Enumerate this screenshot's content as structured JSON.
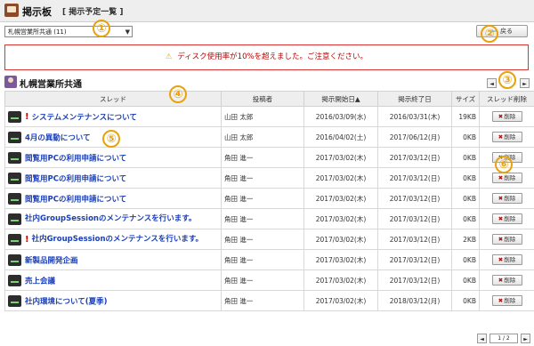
{
  "header": {
    "title": "掲示板",
    "subtitle": "[ 掲示予定一覧 ]"
  },
  "forum_select": {
    "value": "札幌営業所共通 (11)"
  },
  "back_button": {
    "label": "戻る"
  },
  "alert": {
    "text": "ディスク使用率が10%を超えました。ご注意ください。"
  },
  "group": {
    "title": "札幌営業所共通"
  },
  "markers": [
    "①",
    "②",
    "③",
    "④",
    "⑤",
    "⑥"
  ],
  "table": {
    "headers": {
      "thread": "スレッド",
      "poster": "投稿者",
      "start": "掲示開始日▲",
      "end": "掲示終了日",
      "size": "サイズ",
      "delete": "スレッド削除"
    },
    "delete_label": "削除",
    "rows": [
      {
        "title": "システムメンテナンスについて",
        "important": true,
        "poster": "山田 太郎",
        "start": "2016/03/09(水)",
        "end": "2016/03/31(木)",
        "size": "19KB"
      },
      {
        "title": "4月の異動について",
        "important": false,
        "poster": "山田 太郎",
        "start": "2016/04/02(土)",
        "end": "2017/06/12(月)",
        "size": "0KB"
      },
      {
        "title": "閲覧用PCの利用申請について",
        "important": false,
        "poster": "角田 進一",
        "start": "2017/03/02(木)",
        "end": "2017/03/12(日)",
        "size": "0KB"
      },
      {
        "title": "閲覧用PCの利用申請について",
        "important": false,
        "poster": "角田 進一",
        "start": "2017/03/02(木)",
        "end": "2017/03/12(日)",
        "size": "0KB"
      },
      {
        "title": "閲覧用PCの利用申請について",
        "important": false,
        "poster": "角田 進一",
        "start": "2017/03/02(木)",
        "end": "2017/03/12(日)",
        "size": "0KB"
      },
      {
        "title": "社内GroupSessionのメンテナンスを行います。",
        "important": false,
        "poster": "角田 進一",
        "start": "2017/03/02(木)",
        "end": "2017/03/12(日)",
        "size": "0KB"
      },
      {
        "title": "社内GroupSessionのメンテナンスを行います。",
        "important": true,
        "poster": "角田 進一",
        "start": "2017/03/02(木)",
        "end": "2017/03/12(日)",
        "size": "2KB"
      },
      {
        "title": "新製品開発企画",
        "important": false,
        "poster": "角田 進一",
        "start": "2017/03/02(木)",
        "end": "2017/03/12(日)",
        "size": "0KB"
      },
      {
        "title": "売上会議",
        "important": false,
        "poster": "角田 進一",
        "start": "2017/03/02(木)",
        "end": "2017/03/12(日)",
        "size": "0KB"
      },
      {
        "title": "社内環境について(夏季)",
        "important": false,
        "poster": "角田 進一",
        "start": "2017/03/02(木)",
        "end": "2018/03/12(月)",
        "size": "0KB"
      }
    ]
  },
  "pager": {
    "page": "1 / 2"
  },
  "icons": {
    "prev": "◄",
    "next": "►",
    "important": "!",
    "warning": "⚠",
    "delete": "✖",
    "back": "⇦",
    "dropdown": "▼"
  }
}
